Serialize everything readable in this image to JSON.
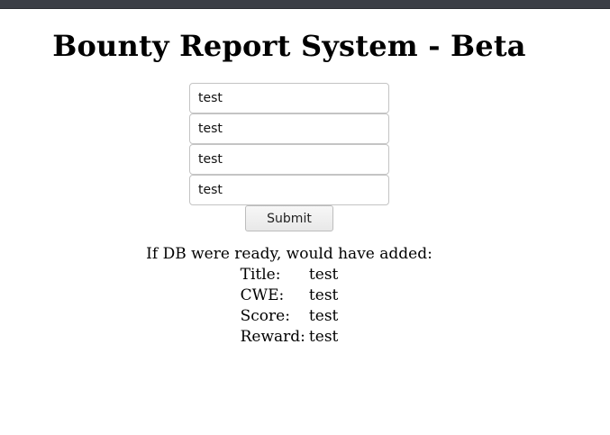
{
  "page": {
    "title": "Bounty Report System - Beta"
  },
  "form": {
    "fields": [
      {
        "name": "title",
        "value": "test"
      },
      {
        "name": "cwe",
        "value": "test"
      },
      {
        "name": "score",
        "value": "test"
      },
      {
        "name": "reward",
        "value": "test"
      }
    ],
    "submit_label": "Submit"
  },
  "result": {
    "heading": "If DB were ready, would have added:",
    "rows": [
      {
        "label": "Title:",
        "value": "test"
      },
      {
        "label": "CWE:",
        "value": "test"
      },
      {
        "label": "Score:",
        "value": "test"
      },
      {
        "label": "Reward:",
        "value": "test"
      }
    ]
  }
}
